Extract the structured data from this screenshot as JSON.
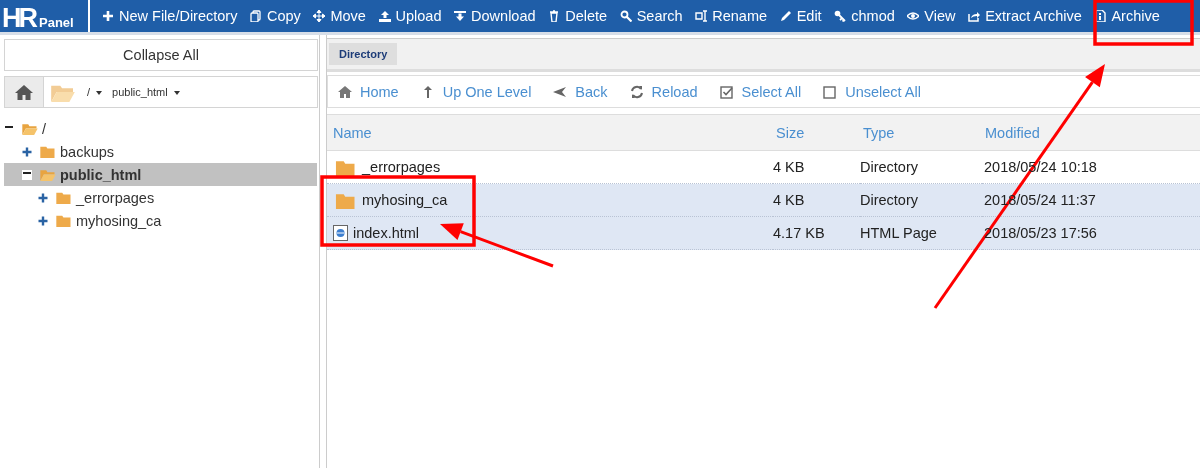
{
  "logo": {
    "main": "HR",
    "sub": "Panel"
  },
  "toolbar": [
    {
      "label": "New File/Directory"
    },
    {
      "label": "Copy"
    },
    {
      "label": "Move"
    },
    {
      "label": "Upload"
    },
    {
      "label": "Download"
    },
    {
      "label": "Delete"
    },
    {
      "label": "Search"
    },
    {
      "label": "Rename"
    },
    {
      "label": "Edit"
    },
    {
      "label": "chmod"
    },
    {
      "label": "View"
    },
    {
      "label": "Extract Archive"
    },
    {
      "label": "Archive"
    }
  ],
  "sidebar": {
    "collapse_button": "Collapse All",
    "path": [
      {
        "label": "/"
      },
      {
        "label": "public_html"
      }
    ],
    "tree": [
      {
        "label": "/",
        "expanded": true,
        "selected": false,
        "children": [
          {
            "label": "backups",
            "expanded": false,
            "selected": false
          },
          {
            "label": "public_html",
            "expanded": true,
            "selected": true,
            "children": [
              {
                "label": "_errorpages",
                "expanded": false,
                "selected": false
              },
              {
                "label": "myhosing_ca",
                "expanded": false,
                "selected": false
              }
            ]
          }
        ]
      }
    ]
  },
  "breadcrumb": [
    {
      "label": "Directory"
    }
  ],
  "nav": [
    {
      "label": "Home"
    },
    {
      "label": "Up One Level"
    },
    {
      "label": "Back"
    },
    {
      "label": "Reload"
    },
    {
      "label": "Select All"
    },
    {
      "label": "Unselect All"
    }
  ],
  "table": {
    "columns": [
      "Name",
      "Size",
      "Type",
      "Modified"
    ],
    "rows": [
      {
        "kind": "folder",
        "name": "_errorpages",
        "size": "4 KB",
        "type": "Directory",
        "modified": "2018/05/24 10:18",
        "selected": false
      },
      {
        "kind": "folder",
        "name": "myhosing_ca",
        "size": "4 KB",
        "type": "Directory",
        "modified": "2018/05/24 11:37",
        "selected": true
      },
      {
        "kind": "html",
        "name": "index.html",
        "size": "4.17 KB",
        "type": "HTML Page",
        "modified": "2018/05/23 17:56",
        "selected": true
      }
    ]
  },
  "annotations": [
    {
      "kind": "box"
    },
    {
      "kind": "box"
    },
    {
      "kind": "arrow"
    },
    {
      "kind": "arrow"
    }
  ]
}
